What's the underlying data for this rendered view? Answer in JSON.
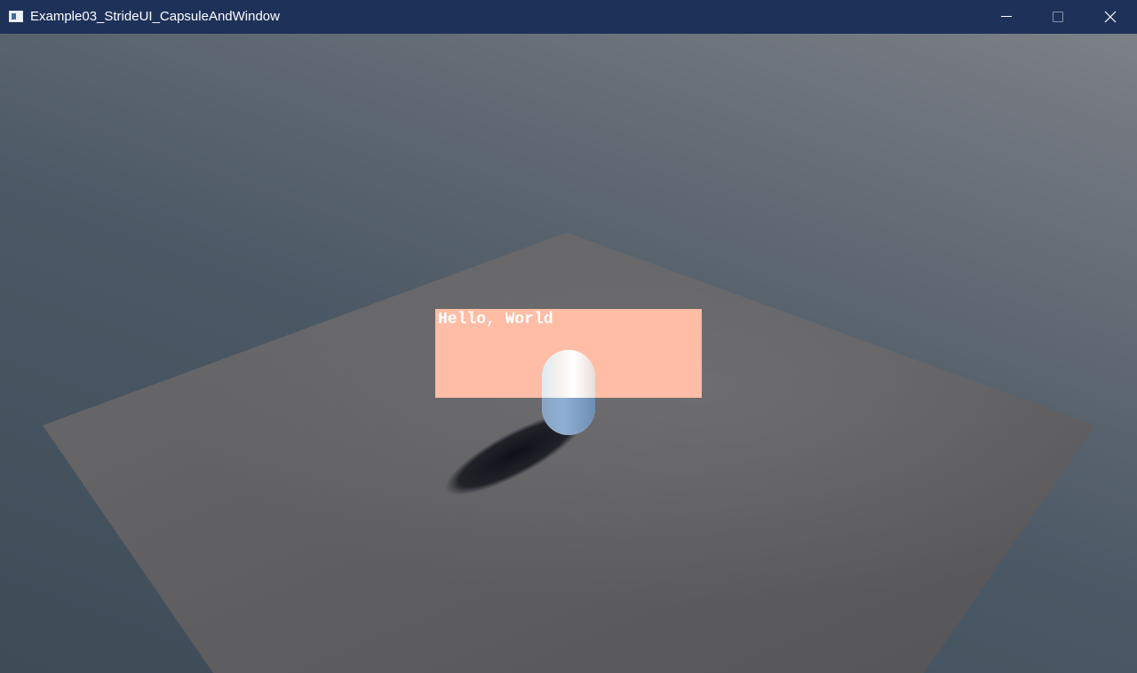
{
  "window": {
    "title": "Example03_StrideUI_CapsuleAndWindow",
    "icon": "app-window-icon",
    "controls": {
      "minimize_icon": "minimize-icon",
      "maximize_icon": "maximize-icon",
      "close_icon": "close-icon"
    },
    "titlebar_color": "#1e3159"
  },
  "scene": {
    "ui_panel": {
      "text": "Hello, World",
      "background_color": "#ffbda6",
      "text_color": "#ffffff"
    },
    "ground_color": "#5e5e60",
    "capsule_colors": {
      "top": "#f7f4ee",
      "bottom": "#8fb0d3"
    }
  }
}
